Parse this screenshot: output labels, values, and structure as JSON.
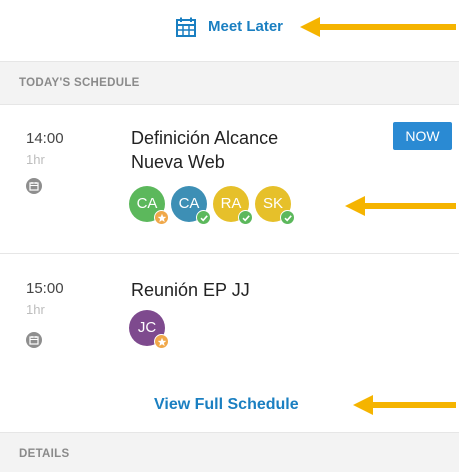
{
  "top": {
    "meet_later_label": "Meet Later",
    "icon": "calendar-grid-icon"
  },
  "sections": {
    "today": "TODAY'S SCHEDULE",
    "details": "DETAILS"
  },
  "events": [
    {
      "time": "14:00",
      "duration": "1hr",
      "title_line1": "Definición Alcance",
      "title_line2": "Nueva Web",
      "badge": "NOW",
      "attendees": [
        {
          "initials": "CA",
          "color": "#5cb85c",
          "status": "organizer-star"
        },
        {
          "initials": "CA",
          "color": "#3d8fb5",
          "status": "accepted-check"
        },
        {
          "initials": "RA",
          "color": "#e6c02a",
          "status": "accepted-check"
        },
        {
          "initials": "SK",
          "color": "#e6c02a",
          "status": "accepted-check"
        }
      ]
    },
    {
      "time": "15:00",
      "duration": "1hr",
      "title_line1": "Reunión EP JJ",
      "attendees": [
        {
          "initials": "JC",
          "color": "#7e4a8e",
          "status": "organizer-star"
        }
      ]
    }
  ],
  "footer_link": "View Full Schedule",
  "colors": {
    "accent": "#1a7fc1",
    "now_badge": "#2a8ad3",
    "annotation_arrow": "#f5b400",
    "star_dot": "#f0a84a",
    "check_dot": "#5cb85c"
  }
}
